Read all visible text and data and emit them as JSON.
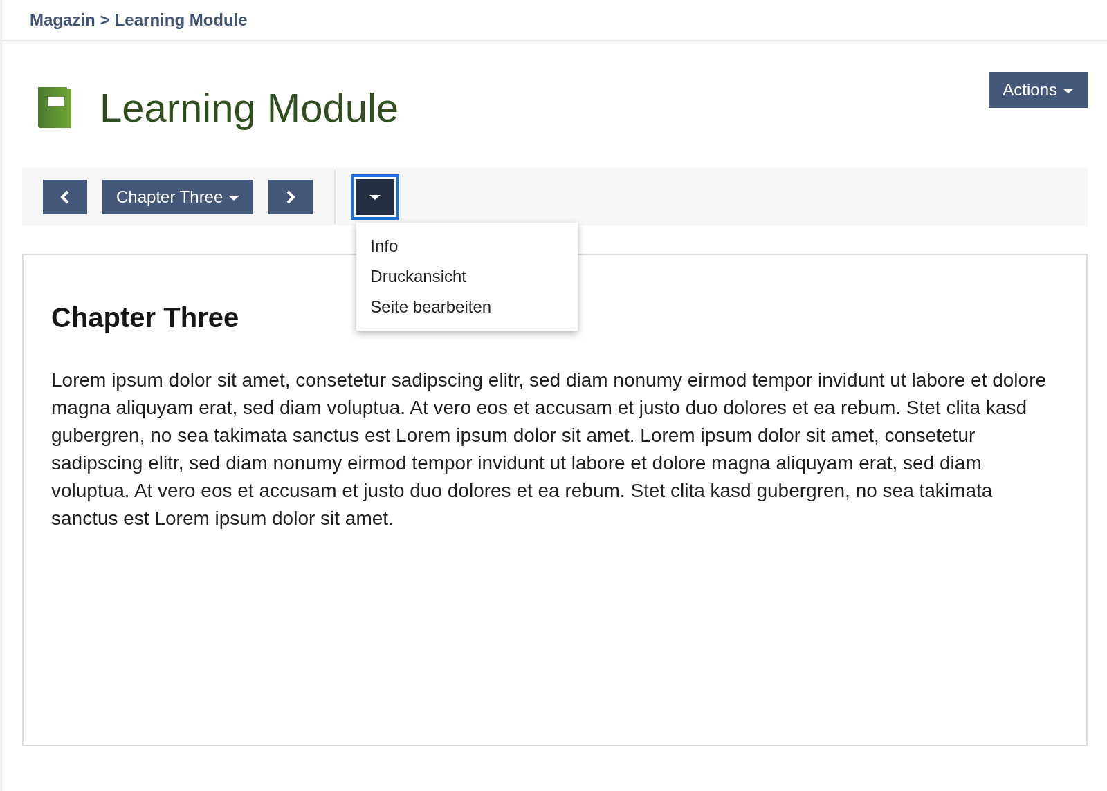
{
  "breadcrumb": [
    {
      "label": "Magazin"
    },
    {
      "label": "Learning Module"
    }
  ],
  "breadcrumb_separator": ">",
  "page_title": "Learning Module",
  "actions_button": {
    "label": "Actions"
  },
  "toolbar": {
    "chapter_selector": {
      "label": "Chapter Three"
    },
    "more_menu": {
      "focused": true,
      "open": true,
      "items": [
        {
          "label": "Info"
        },
        {
          "label": "Druckansicht"
        },
        {
          "label": "Seite bearbeiten"
        }
      ]
    }
  },
  "content": {
    "heading": "Chapter Three",
    "paragraph": "Lorem ipsum dolor sit amet, consetetur sadipscing elitr, sed diam nonumy eirmod tempor invidunt ut labore et dolore magna aliquyam erat, sed diam voluptua. At vero eos et accusam et justo duo dolores et ea rebum. Stet clita kasd gubergren, no sea takimata sanctus est Lorem ipsum dolor sit amet. Lorem ipsum dolor sit amet, consetetur sadipscing elitr, sed diam nonumy eirmod tempor invidunt ut labore et dolore magna aliquyam erat, sed diam voluptua. At vero eos et accusam et justo duo dolores et ea rebum. Stet clita kasd gubergren, no sea takimata sanctus est Lorem ipsum dolor sit amet."
  }
}
